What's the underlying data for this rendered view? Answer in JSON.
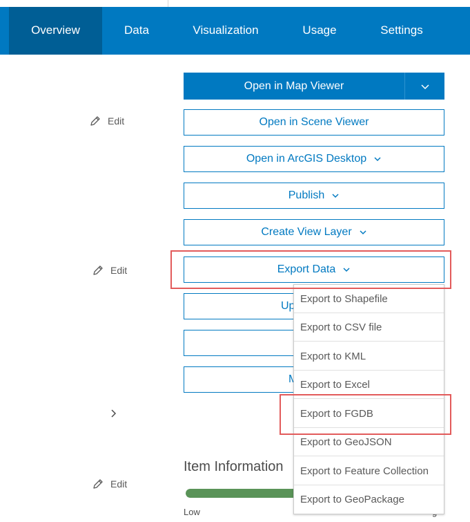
{
  "nav": {
    "tabs": [
      {
        "label": "Overview",
        "active": true
      },
      {
        "label": "Data"
      },
      {
        "label": "Visualization"
      },
      {
        "label": "Usage"
      },
      {
        "label": "Settings"
      }
    ]
  },
  "edit_label": "Edit",
  "actions": {
    "open_map_viewer": "Open in Map Viewer",
    "open_scene_viewer": "Open in Scene Viewer",
    "open_arcgis_desktop": "Open in ArcGIS Desktop",
    "publish": "Publish",
    "create_view_layer": "Create View Layer",
    "export_data": "Export Data",
    "partial_update": "Up",
    "partial_move": "M"
  },
  "export_menu": {
    "items": [
      "Export to Shapefile",
      "Export to CSV file",
      "Export to KML",
      "Export to Excel",
      "Export to FGDB",
      "Export to GeoJSON",
      "Export to Feature Collection",
      "Export to GeoPackage"
    ]
  },
  "item_info": {
    "title": "Item Information",
    "progress_low_label": "Low",
    "progress_value_percent": 45
  },
  "colors": {
    "nav_bg": "#0079c1",
    "nav_active": "#005e95",
    "accent": "#0079c1",
    "progress": "#5a9358",
    "highlight": "#e25a5a"
  }
}
